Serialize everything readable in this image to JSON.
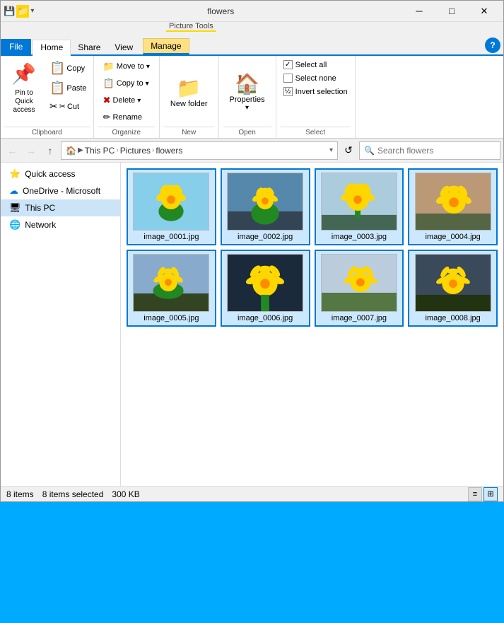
{
  "window": {
    "title": "flowers",
    "titlebar_buttons": [
      "minimize",
      "maximize",
      "close"
    ]
  },
  "quick_access_bar": {
    "folder_icon": "📁",
    "dropdown_arrow": "▾"
  },
  "ribbon": {
    "picture_tools_label": "Picture Tools",
    "tabs": [
      {
        "id": "file",
        "label": "File",
        "active": false
      },
      {
        "id": "home",
        "label": "Home",
        "active": true
      },
      {
        "id": "share",
        "label": "Share",
        "active": false
      },
      {
        "id": "view",
        "label": "View",
        "active": false
      },
      {
        "id": "manage",
        "label": "Manage",
        "active": false
      }
    ],
    "clipboard": {
      "label": "Clipboard",
      "pin_label": "Pin to Quick access",
      "copy_label": "Copy",
      "paste_label": "Paste",
      "cut_icon": "✂",
      "copy_icon": "📋",
      "paste_icon": "📋",
      "pin_icon": "📌"
    },
    "organize": {
      "label": "Organize",
      "move_to_label": "Move to",
      "copy_to_label": "Copy to",
      "delete_label": "Delete",
      "rename_label": "Rename",
      "delete_icon": "✖"
    },
    "new": {
      "label": "New",
      "new_folder_label": "New folder"
    },
    "open": {
      "label": "Open",
      "properties_label": "Properties"
    },
    "select": {
      "label": "Select",
      "select_all_label": "Select all",
      "select_none_label": "Select none",
      "invert_label": "Invert selection"
    }
  },
  "addressbar": {
    "path_segments": [
      "This PC",
      "Pictures",
      "flowers"
    ],
    "search_placeholder": "Search flowers",
    "nav_back": "←",
    "nav_forward": "→",
    "nav_up": "↑",
    "refresh": "↺"
  },
  "sidebar": {
    "items": [
      {
        "id": "quick-access",
        "label": "Quick access",
        "icon": "⭐",
        "type": "header"
      },
      {
        "id": "onedrive",
        "label": "OneDrive - Microsoft",
        "icon": "☁",
        "type": "item"
      },
      {
        "id": "this-pc",
        "label": "This PC",
        "icon": "💻",
        "type": "item",
        "selected": true
      },
      {
        "id": "network",
        "label": "Network",
        "icon": "🌐",
        "type": "item"
      }
    ]
  },
  "files": [
    {
      "name": "image_0001.jpg",
      "selected": true
    },
    {
      "name": "image_0002.jpg",
      "selected": true
    },
    {
      "name": "image_0003.jpg",
      "selected": true
    },
    {
      "name": "image_0004.jpg",
      "selected": true
    },
    {
      "name": "image_0005.jpg",
      "selected": true
    },
    {
      "name": "image_0006.jpg",
      "selected": true
    },
    {
      "name": "image_0007.jpg",
      "selected": true
    },
    {
      "name": "image_0008.jpg",
      "selected": true
    }
  ],
  "statusbar": {
    "items_count": "8 items",
    "selected_count": "8 items selected",
    "file_size": "300 KB"
  },
  "colors": {
    "accent": "#0078d7",
    "selected_bg": "#cce8ff",
    "selected_border": "#0078d7",
    "ribbon_manage_tab": "#ffe082"
  }
}
